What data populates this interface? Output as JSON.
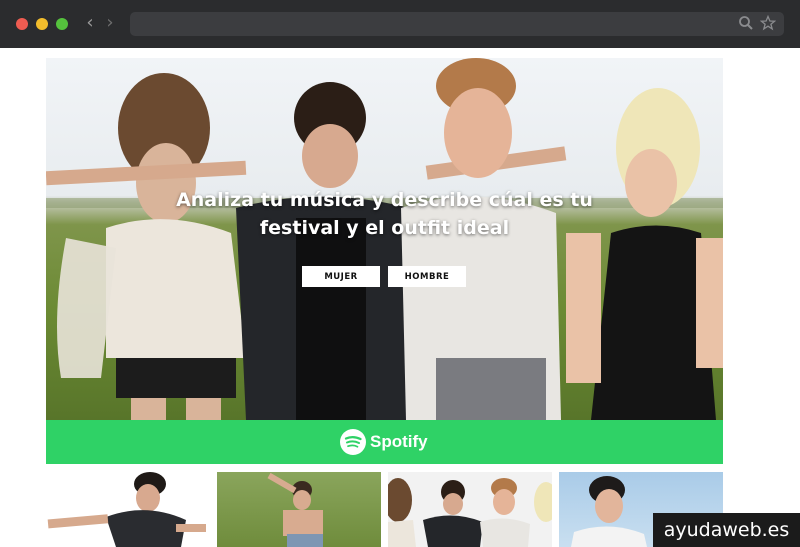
{
  "hero": {
    "headline_line1": "Analiza tu música y describe cúal es tu",
    "headline_line2": "festival y el outfit ideal",
    "btn_mujer": "MUJER",
    "btn_hombre": "HOMBRE"
  },
  "spotify": {
    "wordmark": "Spotify",
    "brand_color": "#2fd266"
  },
  "watermark": "ayudaweb.es",
  "icons": {
    "back": "chevron-left-icon",
    "forward": "chevron-right-icon",
    "search": "search-icon",
    "bookmark": "star-icon"
  }
}
